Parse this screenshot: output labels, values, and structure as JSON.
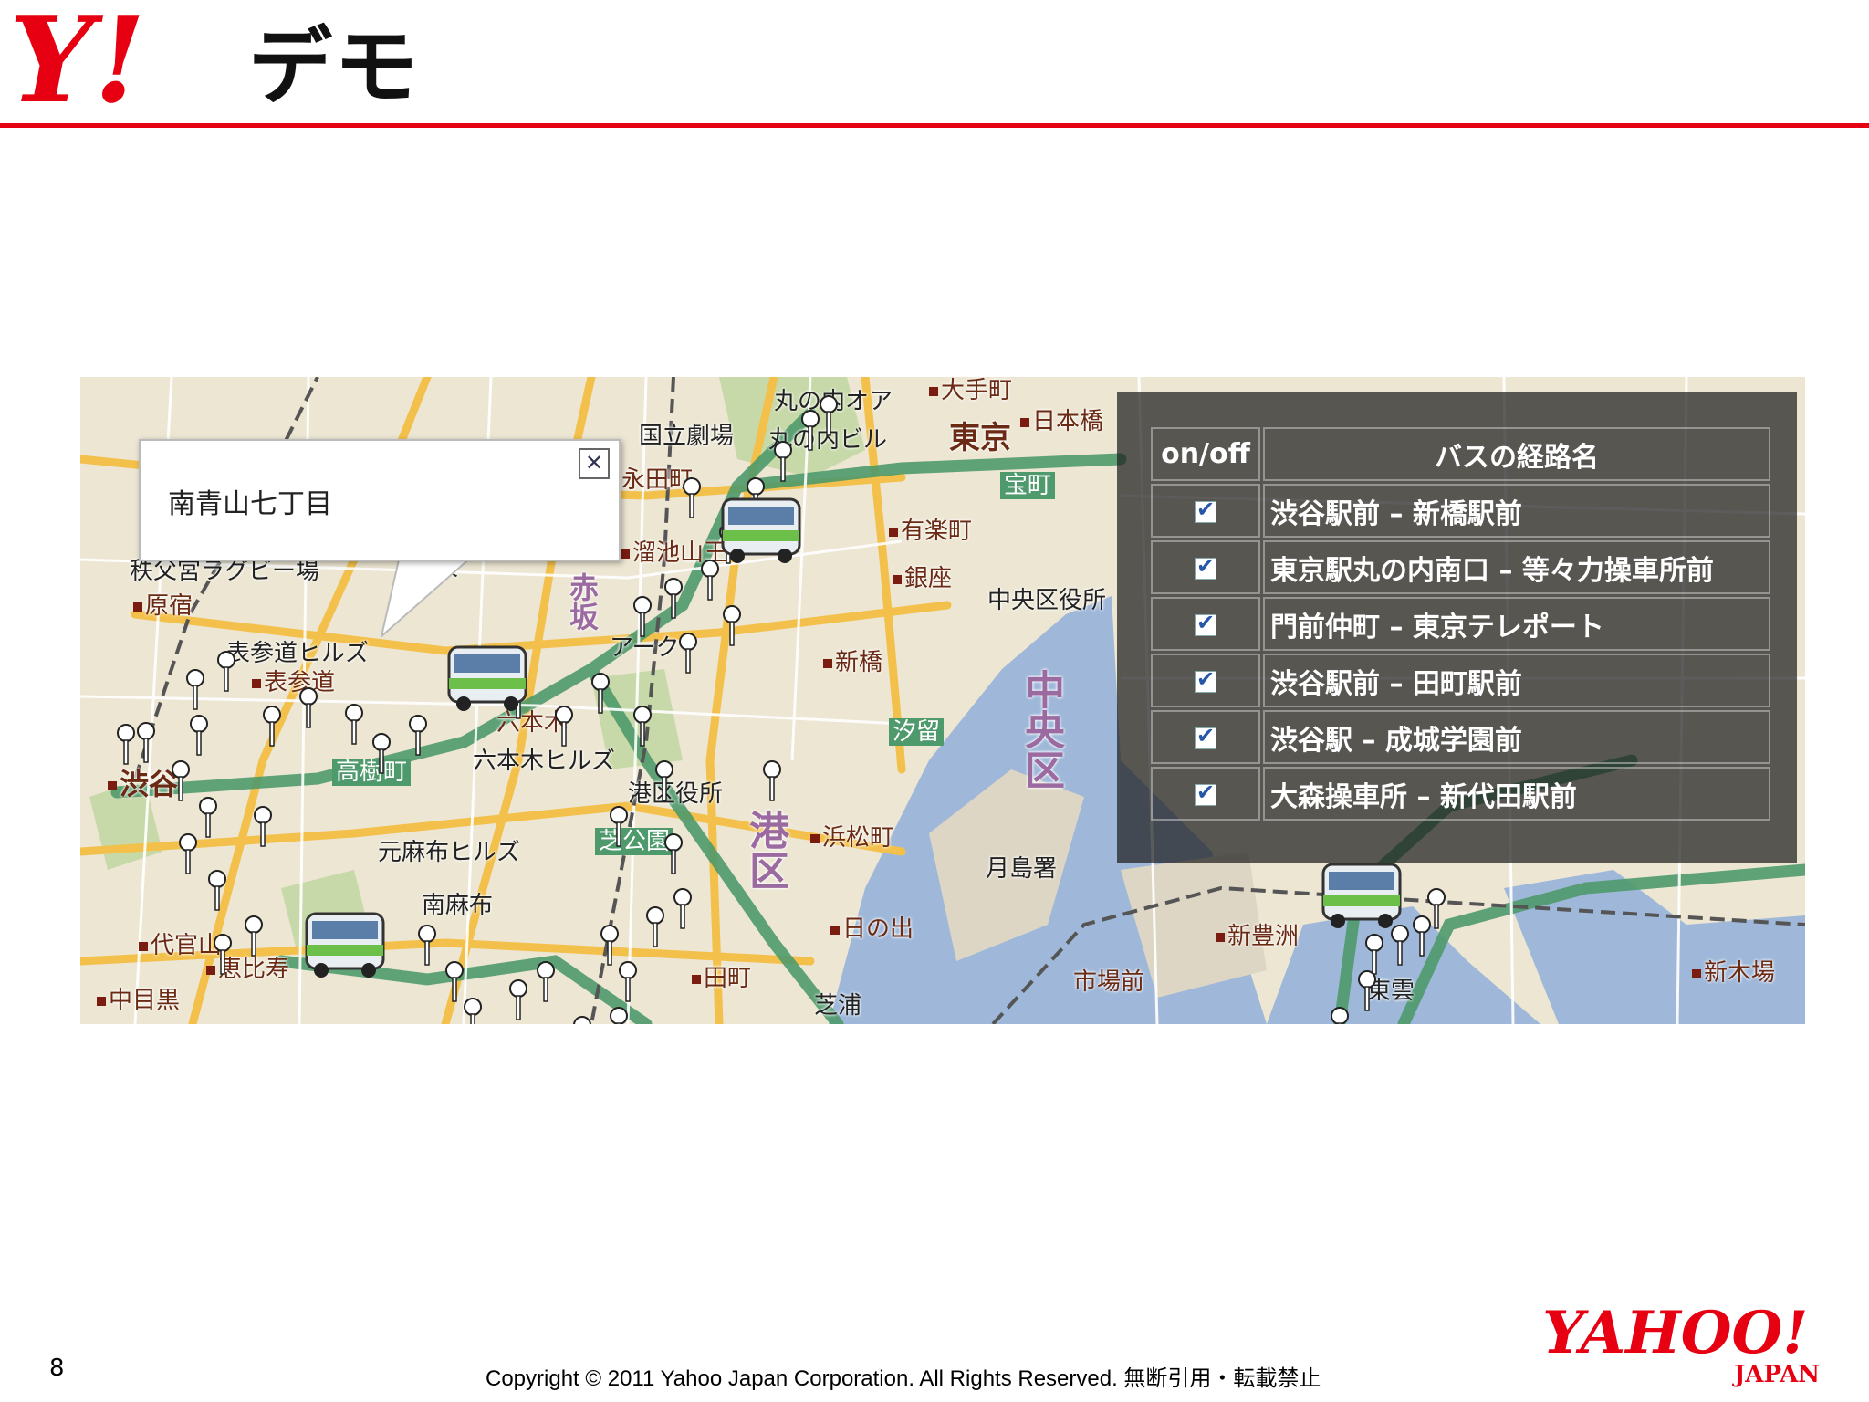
{
  "header": {
    "title": "デモ",
    "logo_text": "Y!"
  },
  "map": {
    "labels": [
      {
        "text": "丸の内オア",
        "cls": "dark"
      },
      {
        "text": "国立劇場",
        "cls": "dark"
      },
      {
        "text": "丸の内ビル",
        "cls": "dark"
      },
      {
        "text": "東京",
        "cls": ""
      },
      {
        "text": "日本橋",
        "cls": ""
      },
      {
        "text": "大手町",
        "cls": ""
      },
      {
        "text": "永田町",
        "cls": ""
      },
      {
        "text": "有楽町",
        "cls": ""
      },
      {
        "text": "宝町",
        "cls": "dark"
      },
      {
        "text": "溜池山王",
        "cls": ""
      },
      {
        "text": "銀座",
        "cls": ""
      },
      {
        "text": "中央区役所",
        "cls": "dark"
      },
      {
        "text": "原宿",
        "cls": ""
      },
      {
        "text": "秩父宮ラグビー場",
        "cls": "dark"
      },
      {
        "text": "赤坂",
        "cls": "dark"
      },
      {
        "text": "表参道ヒルズ",
        "cls": "dark"
      },
      {
        "text": "表参道",
        "cls": ""
      },
      {
        "text": "アーク",
        "cls": "dark"
      },
      {
        "text": "新橋",
        "cls": ""
      },
      {
        "text": "六本木",
        "cls": ""
      },
      {
        "text": "汐留",
        "cls": "dark"
      },
      {
        "text": "高樹町",
        "cls": "dark"
      },
      {
        "text": "六本木ヒルズ",
        "cls": "dark"
      },
      {
        "text": "渋谷",
        "cls": ""
      },
      {
        "text": "港区役所",
        "cls": "dark"
      },
      {
        "text": "浜松町",
        "cls": ""
      },
      {
        "text": "元麻布ヒルズ",
        "cls": "dark"
      },
      {
        "text": "芝公園",
        "cls": "dark"
      },
      {
        "text": "月島署",
        "cls": "dark"
      },
      {
        "text": "南麻布",
        "cls": "dark"
      },
      {
        "text": "代官山",
        "cls": ""
      },
      {
        "text": "恵比寿",
        "cls": ""
      },
      {
        "text": "日の出",
        "cls": ""
      },
      {
        "text": "新豊洲",
        "cls": ""
      },
      {
        "text": "中目黒",
        "cls": ""
      },
      {
        "text": "田町",
        "cls": ""
      },
      {
        "text": "市場前",
        "cls": ""
      },
      {
        "text": "芝浦",
        "cls": "dark"
      },
      {
        "text": "新木場",
        "cls": ""
      },
      {
        "text": "東雲",
        "cls": "dark"
      },
      {
        "text": "中央区",
        "cls": "big"
      },
      {
        "text": "港区",
        "cls": "big"
      },
      {
        "text": "赤坂",
        "cls": "big"
      }
    ]
  },
  "popup": {
    "stop_name": "南青山七丁目",
    "close_symbol": "✕"
  },
  "routes": {
    "header_onoff": "on/off",
    "header_name": "バスの経路名",
    "items": [
      {
        "name": "渋谷駅前 – 新橋駅前",
        "checked": true
      },
      {
        "name": "東京駅丸の内南口 – 等々力操車所前",
        "checked": true
      },
      {
        "name": "門前仲町 – 東京テレポート",
        "checked": true
      },
      {
        "name": "渋谷駅前 – 田町駅前",
        "checked": true
      },
      {
        "name": "渋谷駅 – 成城学園前",
        "checked": true
      },
      {
        "name": "大森操車所 – 新代田駅前",
        "checked": true
      }
    ]
  },
  "footer": {
    "page_number": "8",
    "copyright": "Copyright © 2011 Yahoo Japan Corporation. All Rights Reserved. 無断引用・転載禁止",
    "brand": "YAHOO!",
    "brand_sub": "JAPAN"
  },
  "colors": {
    "accent": "#e60012",
    "water": "#9fb8d9",
    "route_line": "#4f9a6c"
  }
}
